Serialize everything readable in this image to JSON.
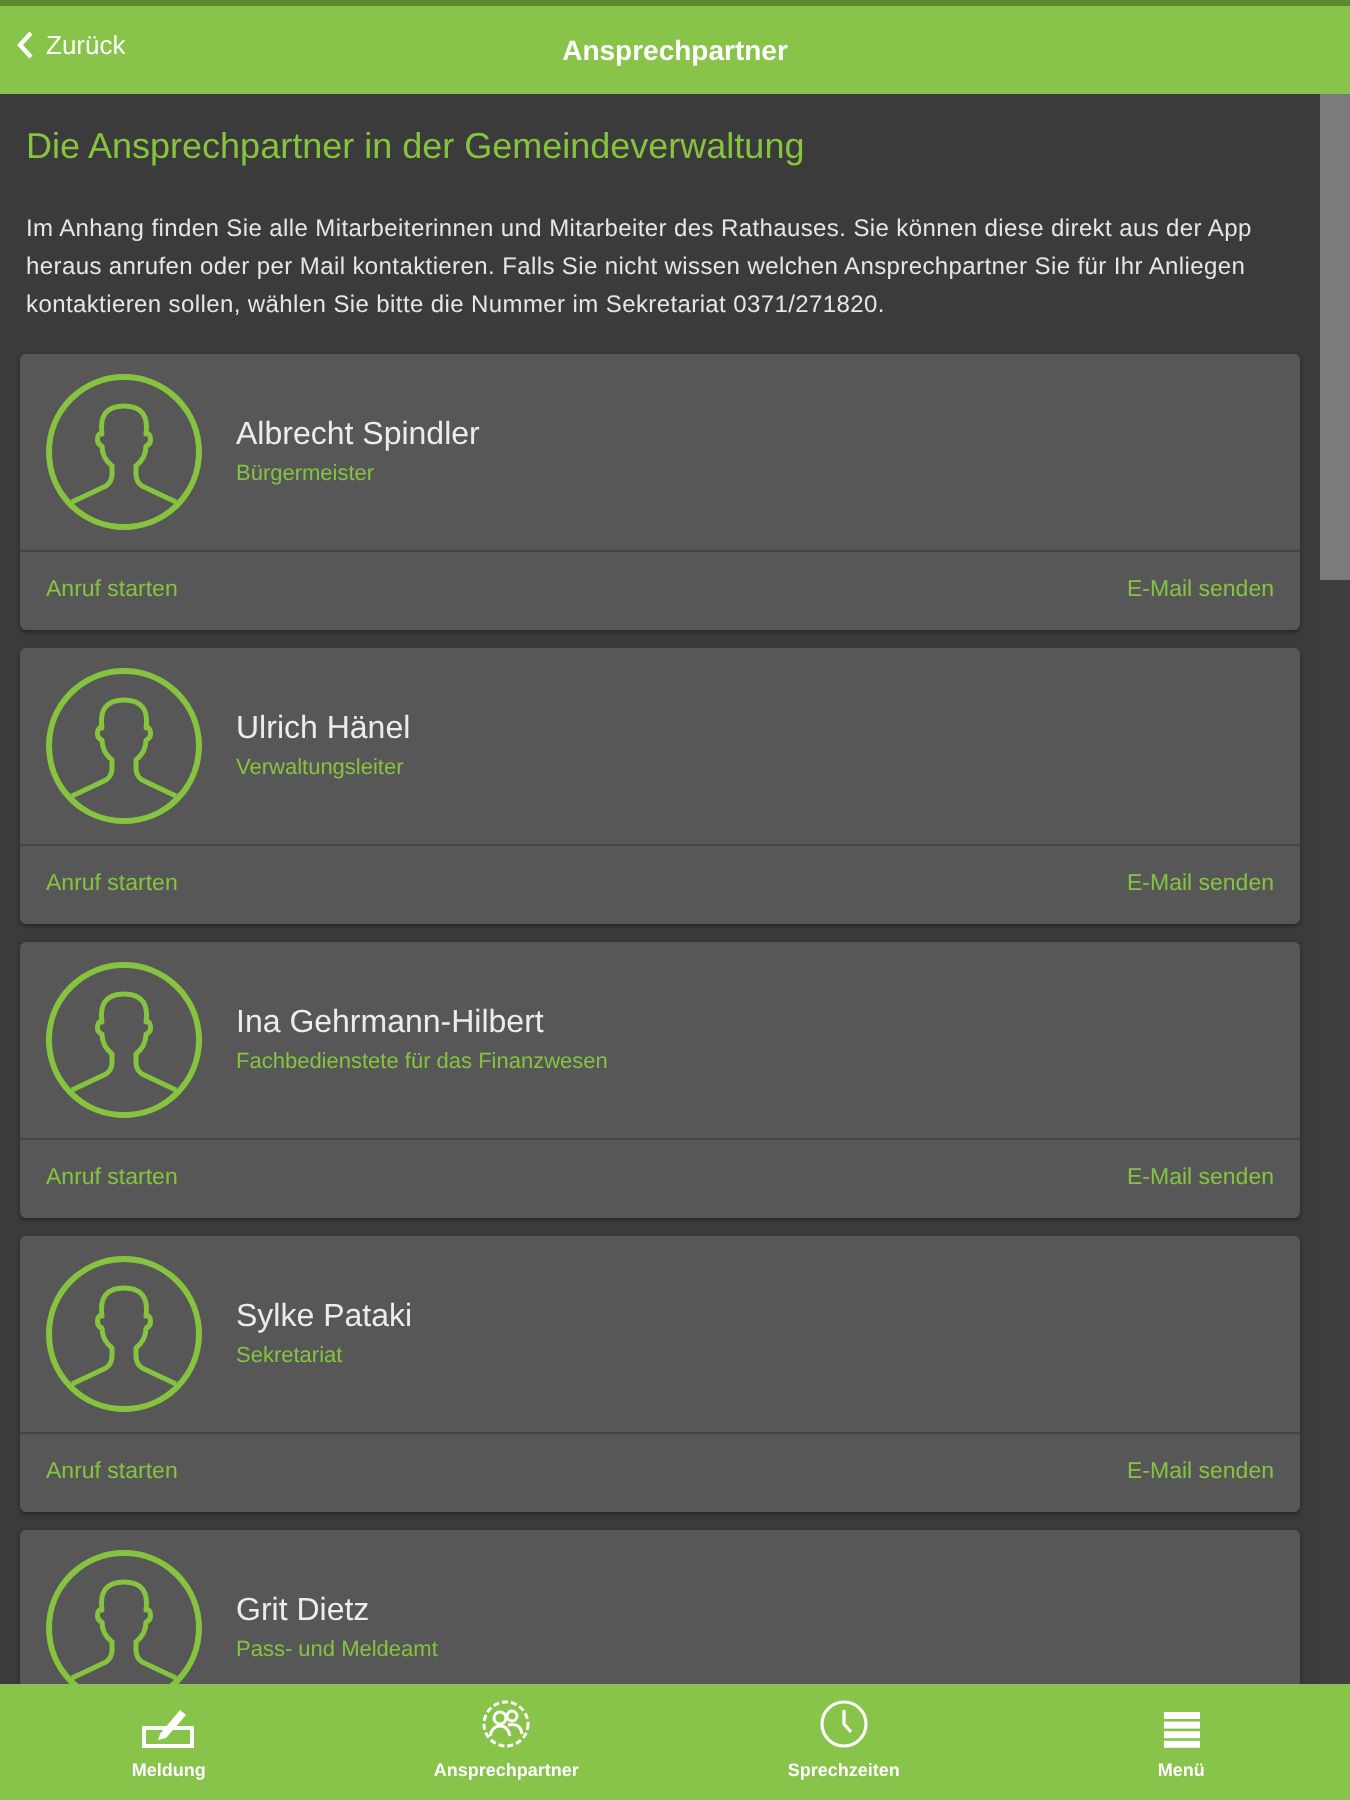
{
  "header": {
    "back_label": "Zurück",
    "title": "Ansprechpartner"
  },
  "intro": {
    "heading": "Die Ansprechpartner in der Gemeindeverwaltung",
    "text": "Im Anhang finden Sie alle Mitarbeiterinnen und Mitarbeiter des Rathauses. Sie können diese direkt aus der App heraus anrufen oder per Mail kontaktieren. Falls Sie nicht wissen welchen Ansprechpartner Sie für Ihr Anliegen kontaktieren sollen, wählen Sie bitte die Nummer im Sekretariat 0371/271820."
  },
  "contacts": [
    {
      "name": "Albrecht Spindler",
      "role": "Bürgermeister",
      "actions": [
        "Anruf starten",
        "E-Mail senden"
      ]
    },
    {
      "name": "Ulrich Hänel",
      "role": "Verwaltungsleiter",
      "actions": [
        "Anruf starten",
        "E-Mail senden"
      ]
    },
    {
      "name": "Ina Gehrmann-Hilbert",
      "role": "Fachbedienstete für das Finanzwesen",
      "actions": [
        "Anruf starten",
        "E-Mail senden"
      ]
    },
    {
      "name": "Sylke Pataki",
      "role": "Sekretariat",
      "actions": [
        "Anruf starten",
        "E-Mail senden"
      ]
    },
    {
      "name": "Grit Dietz",
      "role": "Pass- und Meldeamt"
    }
  ],
  "bottom_nav": [
    {
      "kind": "report",
      "label": "Meldung"
    },
    {
      "kind": "contacts",
      "label": "Ansprechpartner"
    },
    {
      "kind": "hours",
      "label": "Sprechzeiten"
    },
    {
      "kind": "menu",
      "label": "Menü"
    }
  ]
}
